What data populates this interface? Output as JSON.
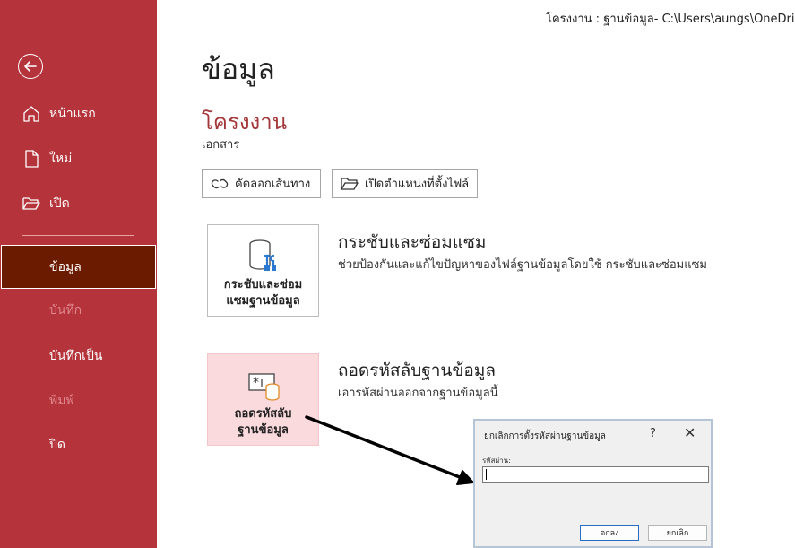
{
  "titlebar": {
    "text": "โครงงาน : ฐานข้อมูล- C:\\Users\\aungs\\OneDrive"
  },
  "sidebar": {
    "back_icon": "back-arrow-icon",
    "items": [
      {
        "label": "หน้าแรก",
        "icon": "home-icon"
      },
      {
        "label": "ใหม่",
        "icon": "new-file-icon"
      },
      {
        "label": "เปิด",
        "icon": "open-folder-icon"
      },
      {
        "label": "ข้อมูล"
      },
      {
        "label": "บันทึก"
      },
      {
        "label": "บันทึกเป็น"
      },
      {
        "label": "พิมพ์"
      },
      {
        "label": "ปิด"
      }
    ]
  },
  "main": {
    "title": "ข้อมูล",
    "project_name": "โครงงาน",
    "project_sub": "เอกสาร",
    "buttons": {
      "copy_path": "คัดลอกเส้นทาง",
      "open_location": "เปิดตำแหน่งที่ตั้งไฟล์"
    },
    "compact": {
      "tile_line1": "กระชับและซ่อม",
      "tile_line2": "แซมฐานข้อมูล",
      "title": "กระชับและซ่อมแซม",
      "desc": "ช่วยป้องกันและแก้ไขปัญหาของไฟล์ฐานข้อมูลโดยใช้ กระชับและซ่อมแซม"
    },
    "decrypt": {
      "tile_line1": "ถอดรหัสลับ",
      "tile_line2": "ฐานข้อมูล",
      "title": "ถอดรหัสลับฐานข้อมูล",
      "desc": "เอารหัสผ่านออกจากฐานข้อมูลนี้"
    }
  },
  "dialog": {
    "title": "ยกเลิกการตั้งรหัสผ่านฐานข้อมูล",
    "help": "?",
    "close": "✕",
    "password_label": "รหัสผ่าน:",
    "password_value": "",
    "ok": "ตกลง",
    "cancel": "ยกเลิก"
  },
  "colors": {
    "sidebar": "#b5333a",
    "active": "#6b1b00",
    "accent_text": "#a4373a",
    "decrypt_tile": "#fadadd"
  }
}
